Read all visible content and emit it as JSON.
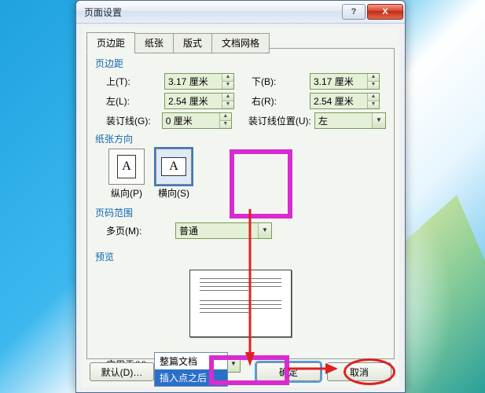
{
  "title": "页面设置",
  "tabs": {
    "t0": "页边距",
    "t1": "纸张",
    "t2": "版式",
    "t3": "文档网格"
  },
  "margins": {
    "section": "页边距",
    "top_label": "上(T):",
    "top_value": "3.17 厘米",
    "bottom_label": "下(B):",
    "bottom_value": "3.17 厘米",
    "left_label": "左(L):",
    "left_value": "2.54 厘米",
    "right_label": "右(R):",
    "right_value": "2.54 厘米",
    "gutter_label": "装订线(G):",
    "gutter_value": "0 厘米",
    "gutter_pos_label": "装订线位置(U):",
    "gutter_pos_value": "左"
  },
  "orientation": {
    "section": "纸张方向",
    "portrait": "纵向(P)",
    "landscape": "横向(S)",
    "glyph": "A"
  },
  "pages": {
    "section": "页码范围",
    "multi_label": "多页(M):",
    "multi_value": "普通"
  },
  "preview": {
    "section": "预览"
  },
  "apply": {
    "label": "应用于(Y):",
    "value": "整篇文档",
    "options": {
      "o0": "整篇文档",
      "o1": "插入点之后"
    }
  },
  "buttons": {
    "default": "默认(D)…",
    "ok": "确定",
    "cancel": "取消"
  }
}
